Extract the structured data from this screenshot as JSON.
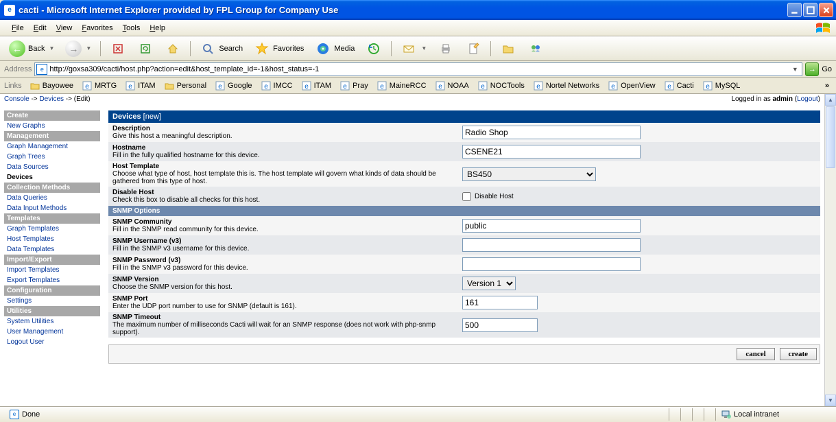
{
  "window": {
    "title": "cacti - Microsoft Internet Explorer provided by FPL Group for Company Use"
  },
  "menubar": [
    "File",
    "Edit",
    "View",
    "Favorites",
    "Tools",
    "Help"
  ],
  "toolbar": {
    "back": "Back",
    "search": "Search",
    "favorites": "Favorites",
    "media": "Media"
  },
  "address": {
    "label": "Address",
    "url": "http://goxsa309/cacti/host.php?action=edit&host_template_id=-1&host_status=-1",
    "go": "Go"
  },
  "linksbar": {
    "label": "Links",
    "items": [
      "Bayowee",
      "MRTG",
      "ITAM",
      "Personal",
      "Google",
      "IMCC",
      "ITAM",
      "Pray",
      "MaineRCC",
      "NOAA",
      "NOCTools",
      "Nortel Networks",
      "OpenView",
      "Cacti",
      "MySQL"
    ]
  },
  "breadcrumb": {
    "console": "Console",
    "devices": "Devices",
    "edit": "(Edit)",
    "logged_in_as": "Logged in as",
    "user": "admin",
    "logout": "Logout"
  },
  "sidebar": {
    "sections": [
      {
        "header": "Create",
        "items": [
          {
            "label": "New Graphs"
          }
        ]
      },
      {
        "header": "Management",
        "items": [
          {
            "label": "Graph Management"
          },
          {
            "label": "Graph Trees"
          },
          {
            "label": "Data Sources"
          },
          {
            "label": "Devices",
            "active": true
          }
        ]
      },
      {
        "header": "Collection Methods",
        "items": [
          {
            "label": "Data Queries"
          },
          {
            "label": "Data Input Methods"
          }
        ]
      },
      {
        "header": "Templates",
        "items": [
          {
            "label": "Graph Templates"
          },
          {
            "label": "Host Templates"
          },
          {
            "label": "Data Templates"
          }
        ]
      },
      {
        "header": "Import/Export",
        "items": [
          {
            "label": "Import Templates"
          },
          {
            "label": "Export Templates"
          }
        ]
      },
      {
        "header": "Configuration",
        "items": [
          {
            "label": "Settings"
          }
        ]
      },
      {
        "header": "Utilities",
        "items": [
          {
            "label": "System Utilities"
          },
          {
            "label": "User Management"
          },
          {
            "label": "Logout User"
          }
        ]
      }
    ]
  },
  "form": {
    "header_main": "Devices",
    "header_sub": "[new]",
    "rows": [
      {
        "label": "Description",
        "desc": "Give this host a meaningful description.",
        "type": "text",
        "value": "Radio Shop"
      },
      {
        "label": "Hostname",
        "desc": "Fill in the fully qualified hostname for this device.",
        "type": "text",
        "value": "CSENE21"
      },
      {
        "label": "Host Template",
        "desc": "Choose what type of host, host template this is. The host template will govern what kinds of data should be gathered from this type of host.",
        "type": "select-wide",
        "value": "BS450"
      },
      {
        "label": "Disable Host",
        "desc": "Check this box to disable all checks for this host.",
        "type": "checkbox",
        "checkbox_label": "Disable Host"
      }
    ],
    "snmp_header": "SNMP Options",
    "snmp_rows": [
      {
        "label": "SNMP Community",
        "desc": "Fill in the SNMP read community for this device.",
        "type": "text",
        "value": "public"
      },
      {
        "label": "SNMP Username (v3)",
        "desc": "Fill in the SNMP v3 username for this device.",
        "type": "text",
        "value": ""
      },
      {
        "label": "SNMP Password (v3)",
        "desc": "Fill in the SNMP v3 password for this device.",
        "type": "text",
        "value": ""
      },
      {
        "label": "SNMP Version",
        "desc": "Choose the SNMP version for this host.",
        "type": "select-narrow",
        "value": "Version 1"
      },
      {
        "label": "SNMP Port",
        "desc": "Enter the UDP port number to use for SNMP (default is 161).",
        "type": "short",
        "value": "161"
      },
      {
        "label": "SNMP Timeout",
        "desc": "The maximum number of milliseconds Cacti will wait for an SNMP response (does not work with php-snmp support).",
        "type": "short",
        "value": "500"
      }
    ],
    "buttons": {
      "cancel": "cancel",
      "create": "create"
    }
  },
  "statusbar": {
    "done": "Done",
    "zone": "Local intranet"
  }
}
